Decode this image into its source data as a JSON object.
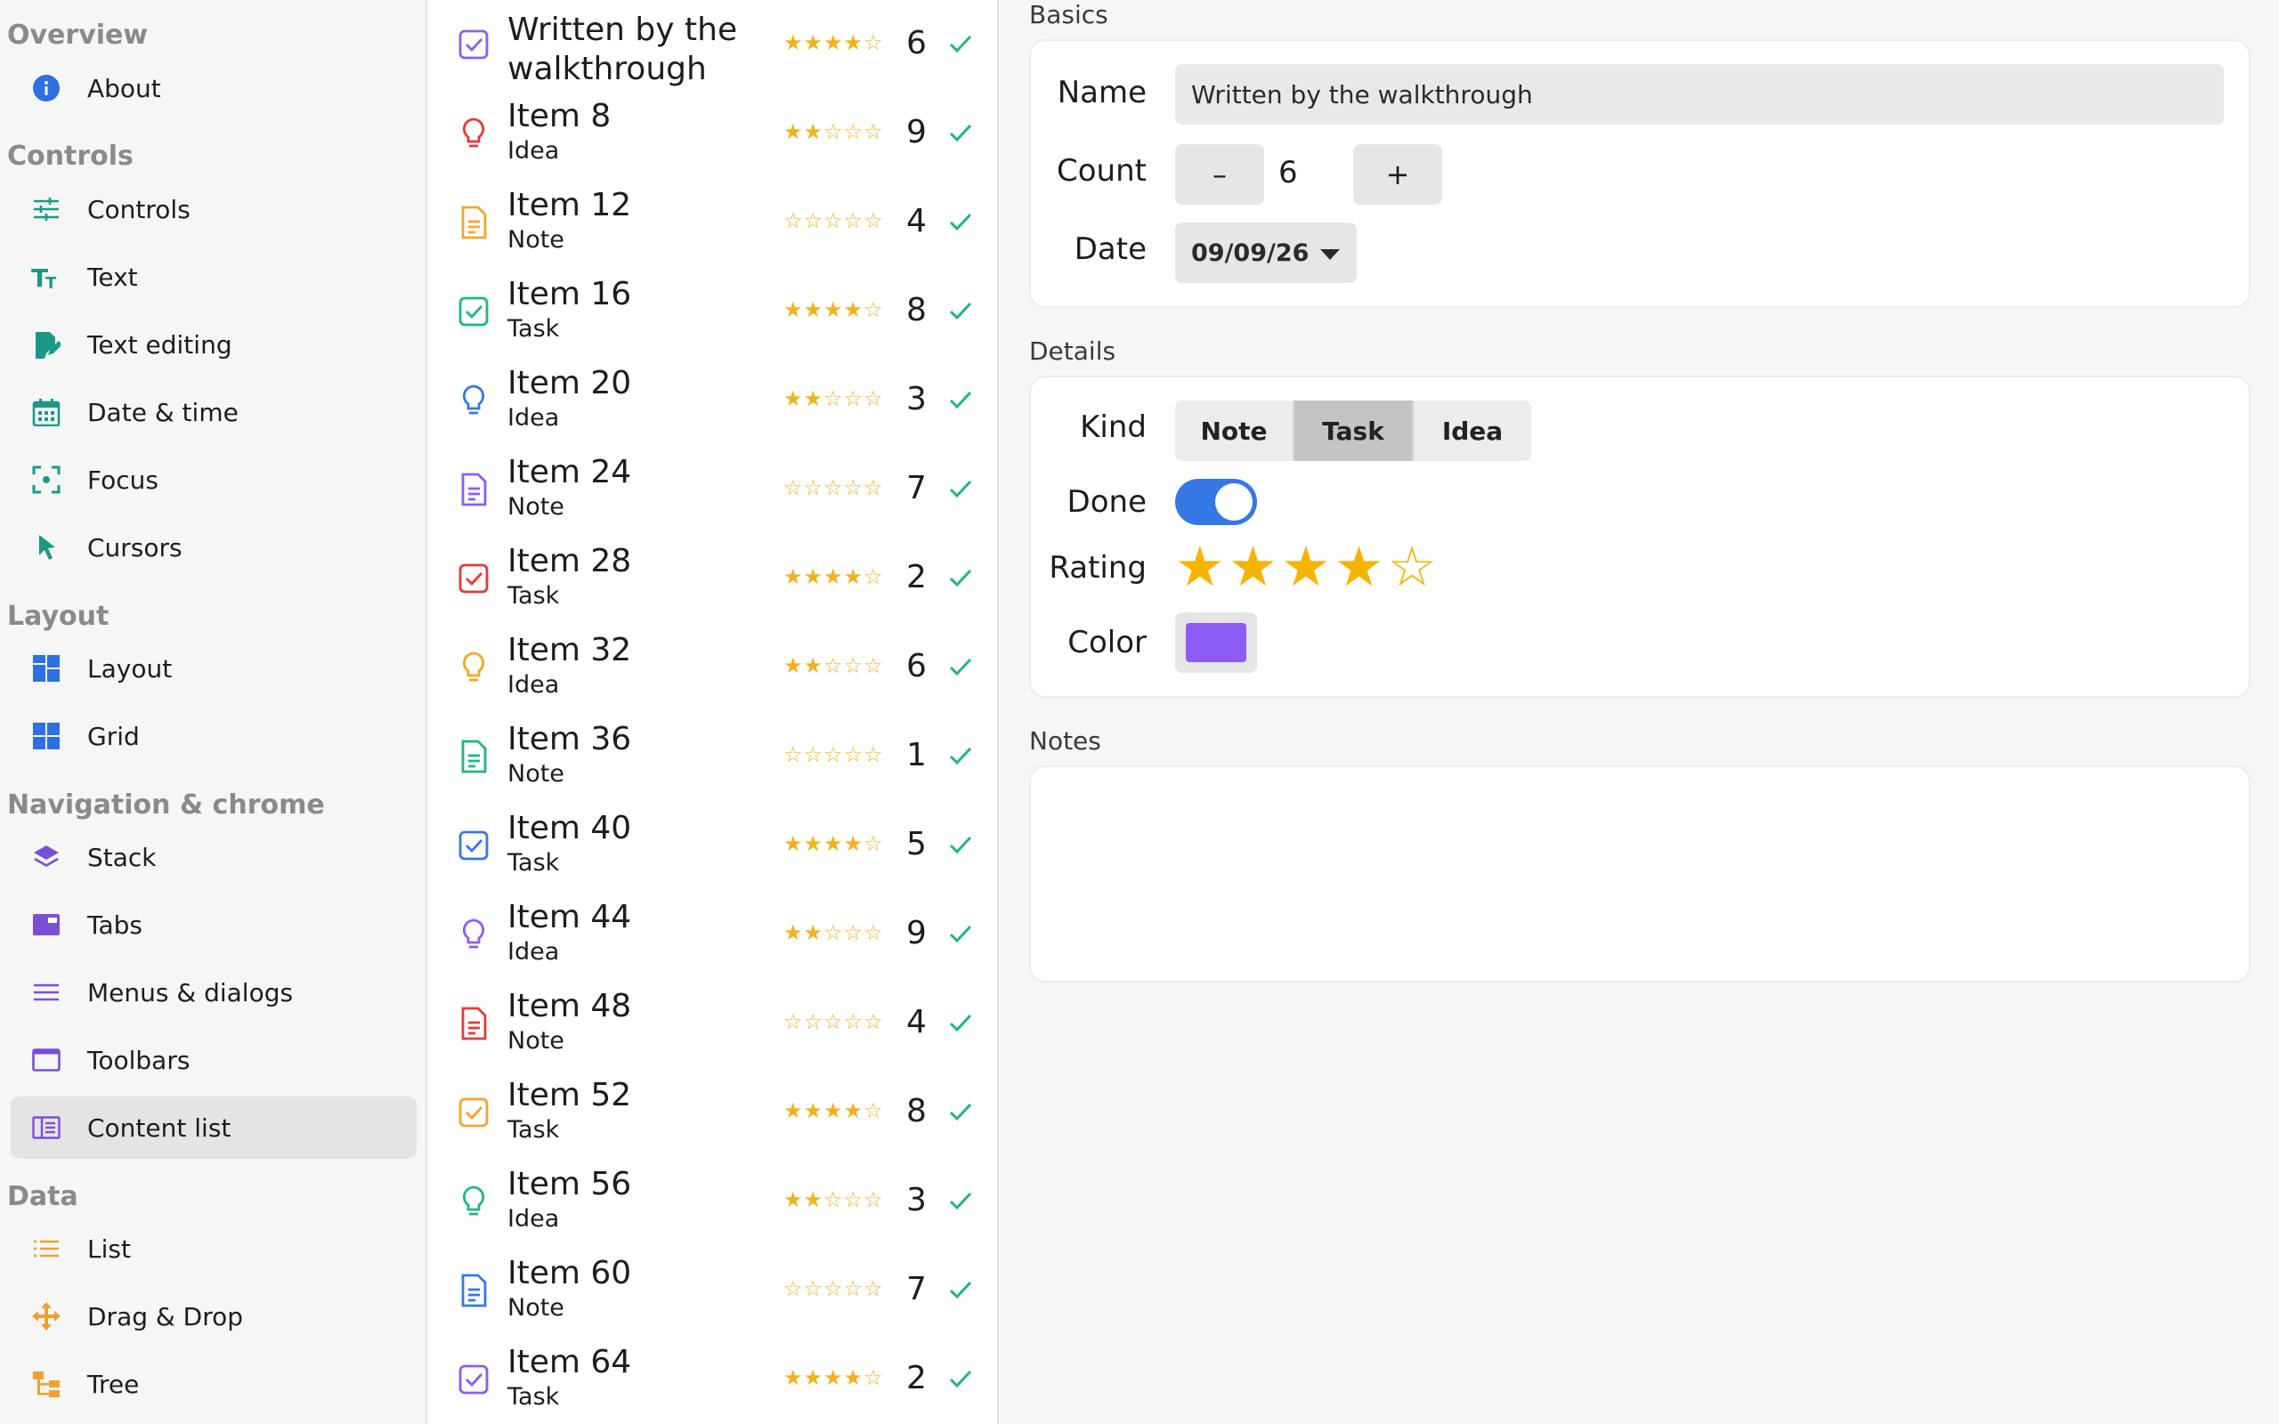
{
  "sidebar": {
    "sections": [
      {
        "header": "Overview",
        "items": [
          {
            "label": "About",
            "icon": "info-icon"
          }
        ]
      },
      {
        "header": "Controls",
        "items": [
          {
            "label": "Controls",
            "icon": "sliders-icon"
          },
          {
            "label": "Text",
            "icon": "text-size-icon"
          },
          {
            "label": "Text editing",
            "icon": "edit-document-icon"
          },
          {
            "label": "Date & time",
            "icon": "calendar-icon"
          },
          {
            "label": "Focus",
            "icon": "focus-icon"
          },
          {
            "label": "Cursors",
            "icon": "cursor-icon"
          }
        ]
      },
      {
        "header": "Layout",
        "items": [
          {
            "label": "Layout",
            "icon": "layout-icon"
          },
          {
            "label": "Grid",
            "icon": "grid-icon"
          }
        ]
      },
      {
        "header": "Navigation & chrome",
        "items": [
          {
            "label": "Stack",
            "icon": "stack-icon"
          },
          {
            "label": "Tabs",
            "icon": "tabs-icon"
          },
          {
            "label": "Menus & dialogs",
            "icon": "menu-icon"
          },
          {
            "label": "Toolbars",
            "icon": "window-icon"
          },
          {
            "label": "Content list",
            "icon": "content-list-icon",
            "selected": true
          }
        ]
      },
      {
        "header": "Data",
        "items": [
          {
            "label": "List",
            "icon": "list-icon"
          },
          {
            "label": "Drag & Drop",
            "icon": "move-icon"
          },
          {
            "label": "Tree",
            "icon": "tree-icon"
          }
        ]
      }
    ]
  },
  "list": {
    "rows": [
      {
        "title": "Written by the walkthrough",
        "subtitle": "",
        "stars": 4,
        "count": "6",
        "icon": "task-icon",
        "color": "#8b5cf6"
      },
      {
        "title": "Item 8",
        "subtitle": "Idea",
        "stars": 2,
        "count": "9",
        "icon": "idea-icon",
        "color": "#e53935"
      },
      {
        "title": "Item 12",
        "subtitle": "Note",
        "stars": 0,
        "count": "4",
        "icon": "note-icon",
        "color": "#f5a623"
      },
      {
        "title": "Item 16",
        "subtitle": "Task",
        "stars": 4,
        "count": "8",
        "icon": "task-icon",
        "color": "#1fb589"
      },
      {
        "title": "Item 20",
        "subtitle": "Idea",
        "stars": 2,
        "count": "3",
        "icon": "idea-icon",
        "color": "#3478e6"
      },
      {
        "title": "Item 24",
        "subtitle": "Note",
        "stars": 0,
        "count": "7",
        "icon": "note-icon",
        "color": "#8b5cf6"
      },
      {
        "title": "Item 28",
        "subtitle": "Task",
        "stars": 4,
        "count": "2",
        "icon": "task-icon",
        "color": "#e53935"
      },
      {
        "title": "Item 32",
        "subtitle": "Idea",
        "stars": 2,
        "count": "6",
        "icon": "idea-icon",
        "color": "#f5a623"
      },
      {
        "title": "Item 36",
        "subtitle": "Note",
        "stars": 0,
        "count": "1",
        "icon": "note-icon",
        "color": "#1fb589"
      },
      {
        "title": "Item 40",
        "subtitle": "Task",
        "stars": 4,
        "count": "5",
        "icon": "task-icon",
        "color": "#3478e6"
      },
      {
        "title": "Item 44",
        "subtitle": "Idea",
        "stars": 2,
        "count": "9",
        "icon": "idea-icon",
        "color": "#8b5cf6"
      },
      {
        "title": "Item 48",
        "subtitle": "Note",
        "stars": 0,
        "count": "4",
        "icon": "note-icon",
        "color": "#e53935"
      },
      {
        "title": "Item 52",
        "subtitle": "Task",
        "stars": 4,
        "count": "8",
        "icon": "task-icon",
        "color": "#f5a623"
      },
      {
        "title": "Item 56",
        "subtitle": "Idea",
        "stars": 2,
        "count": "3",
        "icon": "idea-icon",
        "color": "#1fb589"
      },
      {
        "title": "Item 60",
        "subtitle": "Note",
        "stars": 0,
        "count": "7",
        "icon": "note-icon",
        "color": "#3478e6"
      },
      {
        "title": "Item 64",
        "subtitle": "Task",
        "stars": 4,
        "count": "2",
        "icon": "task-icon",
        "color": "#8b5cf6"
      }
    ],
    "check_color": "#1fb589",
    "star_color": "#f2b11e"
  },
  "detail": {
    "basics": {
      "title": "Basics",
      "name_label": "Name",
      "name_value": "Written by the walkthrough",
      "count_label": "Count",
      "count_value": "6",
      "minus": "–",
      "plus": "+",
      "date_label": "Date",
      "date_value": "09/09/26"
    },
    "details": {
      "title": "Details",
      "kind_label": "Kind",
      "kind_options": [
        "Note",
        "Task",
        "Idea"
      ],
      "kind_selected": "Task",
      "done_label": "Done",
      "done": true,
      "rating_label": "Rating",
      "rating": 4,
      "rating_max": 5,
      "color_label": "Color",
      "color_value": "#8b5cf6"
    },
    "notes": {
      "title": "Notes",
      "text": ""
    }
  }
}
